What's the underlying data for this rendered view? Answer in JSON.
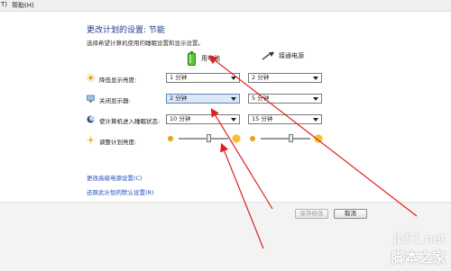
{
  "menubar": {
    "item1": "T)",
    "item2": "帮助(H)"
  },
  "header": {
    "title": "更改计划的设置: 节能",
    "subtitle": "选择希望计算机使用的睡眠设置和显示设置。"
  },
  "columns": {
    "battery": "用电池",
    "plugged": "接通电源"
  },
  "rows": [
    {
      "label": "降低显示亮度:",
      "battery": "1 分钟",
      "plugged": "2 分钟"
    },
    {
      "label": "关闭显示器:",
      "battery": "2 分钟",
      "plugged": "5 分钟"
    },
    {
      "label": "使计算机进入睡眠状态:",
      "battery": "10 分钟",
      "plugged": "15 分钟"
    },
    {
      "label": "调整计划亮度:"
    }
  ],
  "brightness": {
    "battery_level": 0.6,
    "plugged_level": 0.6
  },
  "links": {
    "advanced": "更改高级电源设置(C)",
    "restore": "还原此计划的默认设置(R)"
  },
  "buttons": {
    "save": "保存修改",
    "cancel": "取消"
  },
  "watermark": {
    "site": "jb51.net",
    "name": "脚本之家"
  },
  "colors": {
    "title": "#1e3a8f",
    "link": "#1f4fbf",
    "arrow": "#e02020",
    "highlight": "#dbe8f7"
  }
}
